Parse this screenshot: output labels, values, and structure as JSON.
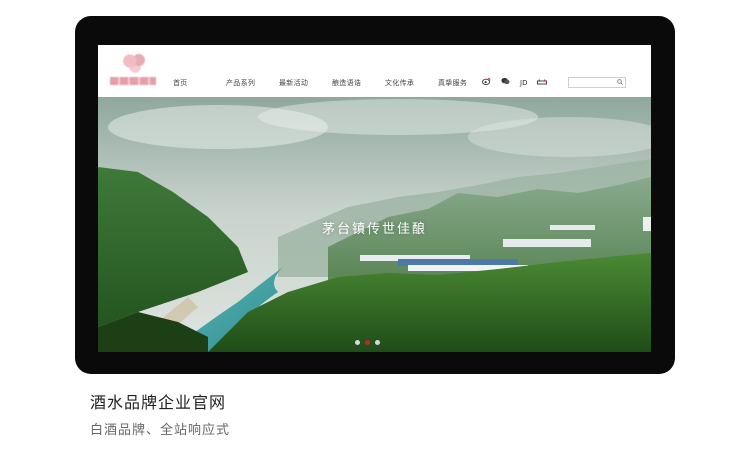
{
  "nav": {
    "items": [
      "首页",
      "产品系列",
      "最新活动",
      "酿造语诰",
      "文化传承",
      "真挚服务"
    ]
  },
  "social": {
    "icons": [
      "weibo-icon",
      "wechat-icon",
      "jd-icon",
      "tmall-icon"
    ],
    "jd_label": "JD"
  },
  "search": {
    "placeholder": ""
  },
  "hero": {
    "title": "茅台镇传世佳酿",
    "slides": 3,
    "active_slide": 2,
    "accent": "#c0272d"
  },
  "caption": {
    "title": "酒水品牌企业官网",
    "subtitle": "白酒品牌、全站响应式"
  }
}
